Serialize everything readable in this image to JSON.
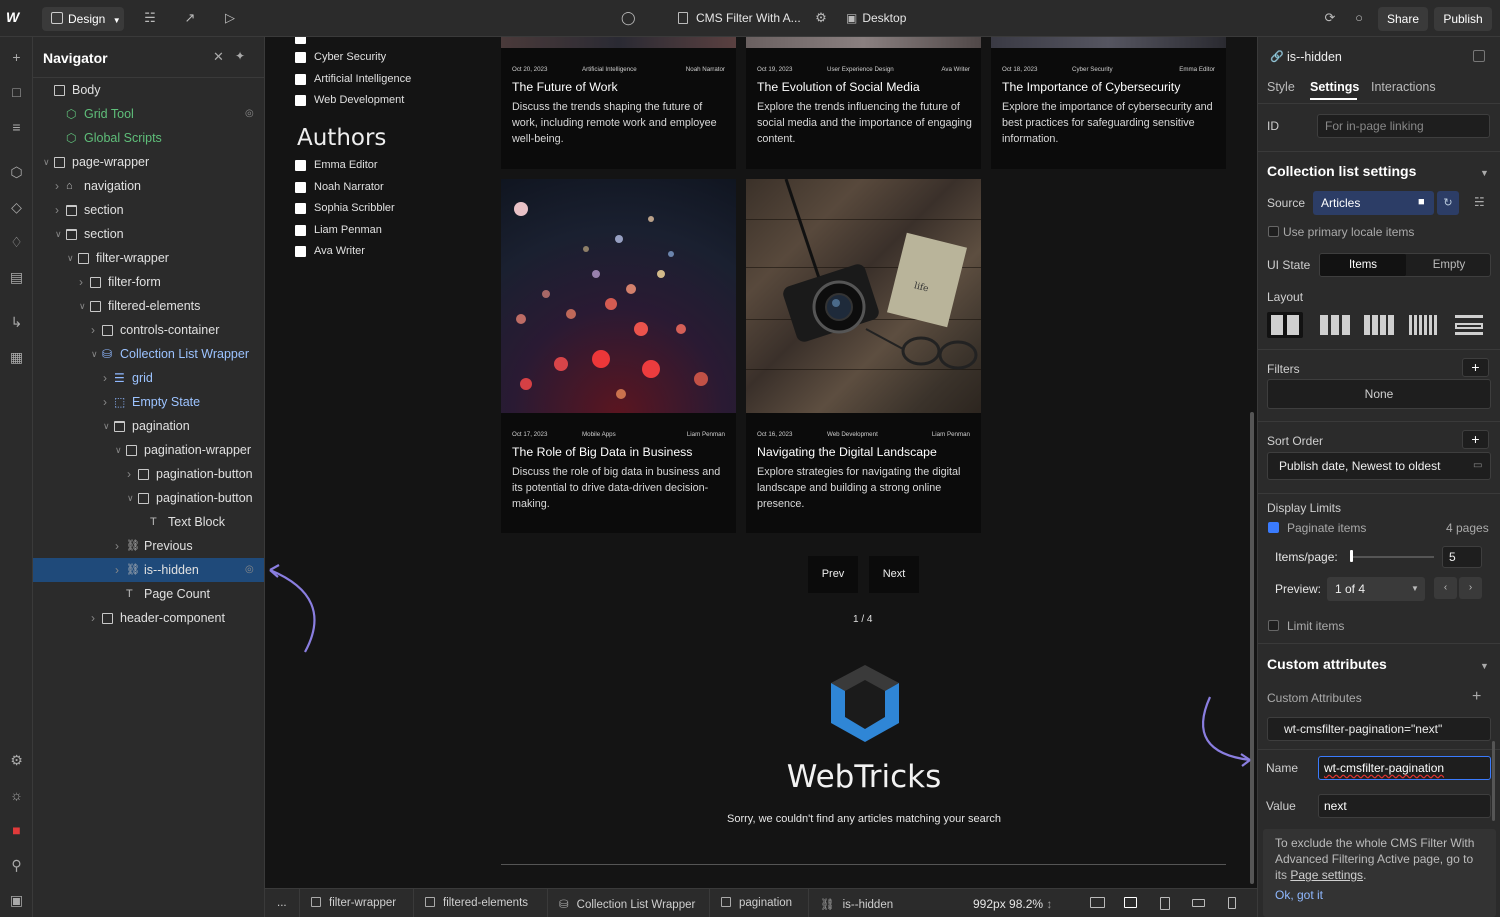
{
  "topbar": {
    "mode": "Design",
    "page_title": "CMS Filter With A...",
    "device": "Desktop",
    "share": "Share",
    "publish": "Publish"
  },
  "navigator": {
    "title": "Navigator",
    "tree": [
      {
        "label": "Body",
        "depth": 0,
        "icon": "box",
        "chevron": false
      },
      {
        "label": "Grid Tool",
        "depth": 1,
        "icon": "component-green",
        "color": "green",
        "chevron": false,
        "eye": true
      },
      {
        "label": "Global Scripts",
        "depth": 1,
        "icon": "component-green",
        "color": "green",
        "chevron": false
      },
      {
        "label": "page-wrapper",
        "depth": 0,
        "icon": "box",
        "chevron": "open"
      },
      {
        "label": "navigation",
        "depth": 1,
        "icon": "home",
        "chevron": "closed"
      },
      {
        "label": "section",
        "depth": 1,
        "icon": "section",
        "chevron": "closed"
      },
      {
        "label": "section",
        "depth": 1,
        "icon": "section",
        "chevron": "open"
      },
      {
        "label": "filter-wrapper",
        "depth": 2,
        "icon": "box",
        "chevron": "open"
      },
      {
        "label": "filter-form",
        "depth": 3,
        "icon": "box",
        "chevron": "closed"
      },
      {
        "label": "filtered-elements",
        "depth": 3,
        "icon": "box",
        "chevron": "open"
      },
      {
        "label": "controls-container",
        "depth": 4,
        "icon": "box",
        "chevron": "closed"
      },
      {
        "label": "Collection List Wrapper",
        "depth": 4,
        "icon": "db",
        "color": "blue",
        "chevron": "open"
      },
      {
        "label": "grid",
        "depth": 5,
        "icon": "list",
        "color": "blue",
        "chevron": "closed"
      },
      {
        "label": "Empty State",
        "depth": 5,
        "icon": "empty",
        "color": "blue",
        "chevron": "closed"
      },
      {
        "label": "pagination",
        "depth": 5,
        "icon": "section",
        "chevron": "open"
      },
      {
        "label": "pagination-wrapper",
        "depth": 6,
        "icon": "box",
        "chevron": "open"
      },
      {
        "label": "pagination-button",
        "depth": 7,
        "icon": "box",
        "chevron": "closed"
      },
      {
        "label": "pagination-button",
        "depth": 7,
        "icon": "box",
        "chevron": "open"
      },
      {
        "label": "Text Block",
        "depth": 8,
        "icon": "text",
        "chevron": false
      },
      {
        "label": "Previous",
        "depth": 6,
        "icon": "link",
        "chevron": "closed"
      },
      {
        "label": "is--hidden",
        "depth": 6,
        "icon": "link",
        "chevron": "closed",
        "selected": true,
        "eye": true
      },
      {
        "label": "Page Count",
        "depth": 6,
        "icon": "text",
        "chevron": false
      },
      {
        "label": "header-component",
        "depth": 4,
        "icon": "box",
        "chevron": "closed"
      }
    ]
  },
  "canvas": {
    "categories": [
      "Cyber Security",
      "Artificial Intelligence",
      "Web Development"
    ],
    "authors_heading": "Authors",
    "authors": [
      "Emma Editor",
      "Noah Narrator",
      "Sophia Scribbler",
      "Liam Penman",
      "Ava Writer"
    ],
    "cards": [
      {
        "date": "Oct 20, 2023",
        "category": "Artificial Intelligence",
        "author": "Noah Narrator",
        "title": "The Future of Work",
        "desc": "Discuss the trends shaping the future of work, including remote work and employee well-being."
      },
      {
        "date": "Oct 19, 2023",
        "category": "User Experience Design",
        "author": "Ava Writer",
        "title": "The Evolution of Social Media",
        "desc": "Explore the trends influencing the future of social media and the importance of engaging content."
      },
      {
        "date": "Oct 18, 2023",
        "category": "Cyber Security",
        "author": "Emma Editor",
        "title": "The Importance of Cybersecurity",
        "desc": "Explore the importance of cybersecurity and best practices for safeguarding sensitive information."
      },
      {
        "date": "Oct 17, 2023",
        "category": "Mobile Apps",
        "author": "Liam Penman",
        "title": "The Role of Big Data in Business",
        "desc": "Discuss the role of big data in business and its potential to drive data-driven decision-making."
      },
      {
        "date": "Oct 16, 2023",
        "category": "Web Development",
        "author": "Liam Penman",
        "title": "Navigating the Digital Landscape",
        "desc": "Explore strategies for navigating the digital landscape and building a strong online presence."
      }
    ],
    "prev": "Prev",
    "next": "Next",
    "page_count": "1 / 4",
    "brand": "WebTricks",
    "empty_message": "Sorry, we couldn't find any articles matching your search"
  },
  "breadcrumbs": {
    "more": "...",
    "items": [
      "filter-wrapper",
      "filtered-elements",
      "Collection List Wrapper",
      "pagination",
      "is--hidden"
    ],
    "size": "992px 98.2%"
  },
  "panel": {
    "element": "is--hidden",
    "tabs": [
      "Style",
      "Settings",
      "Interactions"
    ],
    "id_label": "ID",
    "id_placeholder": "For in-page linking",
    "collection_heading": "Collection list settings",
    "source_label": "Source",
    "source_value": "Articles",
    "primary_locale": "Use primary locale items",
    "ui_state_label": "UI State",
    "ui_state_items": "Items",
    "ui_state_empty": "Empty",
    "layout_label": "Layout",
    "filters_label": "Filters",
    "filters_value": "None",
    "sort_label": "Sort Order",
    "sort_value": "Publish date, Newest to oldest",
    "display_limits": "Display Limits",
    "paginate": "Paginate items",
    "pages": "4 pages",
    "items_per_page_label": "Items/page:",
    "items_per_page": "5",
    "preview_label": "Preview:",
    "preview_value": "1 of 4",
    "limit_items": "Limit items",
    "custom_attributes_heading": "Custom attributes",
    "custom_attributes_label": "Custom Attributes",
    "attribute": "wt-cmsfilter-pagination=\"next\"",
    "name_label": "Name",
    "name_value": "wt-cmsfilter-pagination",
    "value_label": "Value",
    "value_value": "next",
    "tip_text": "To exclude the whole CMS Filter With Advanced Filtering Active page, go to its ",
    "tip_link": "Page settings",
    "tip_end": ".",
    "tip_ok": "Ok, got it"
  },
  "colors": {
    "accent": "#3a7bfd",
    "selection": "#1f4a7a",
    "component": "#5fbf7a",
    "collection": "#9cc3ff",
    "brand_logo": "#2f86d6"
  }
}
